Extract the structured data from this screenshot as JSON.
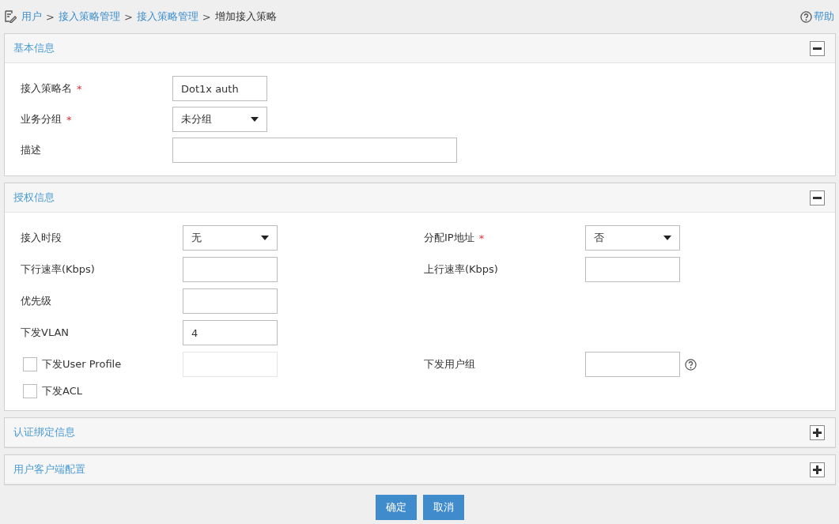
{
  "breadcrumb": [
    {
      "text": "用户",
      "link": true
    },
    {
      "text": "接入策略管理",
      "link": true
    },
    {
      "text": "接入策略管理",
      "link": true
    },
    {
      "text": "增加接入策略",
      "link": false
    }
  ],
  "breadcrumb_separator": ">",
  "help": "帮助",
  "sections": [
    {
      "title": "基本信息",
      "expanded": true,
      "kind": "single",
      "rows": [
        [
          {
            "kind": "text",
            "label": "接入策略名",
            "mark": "*",
            "value": "Dot1x auth"
          }
        ],
        [
          {
            "kind": "select",
            "label": "业务分组",
            "mark": "*",
            "value": "未分组"
          }
        ],
        [
          {
            "kind": "wide-text",
            "label": "描述"
          }
        ]
      ]
    },
    {
      "title": "授权信息",
      "expanded": true,
      "kind": "double",
      "rows": [
        [
          {
            "kind": "select",
            "label": "接入时段",
            "value": "无"
          },
          {
            "kind": "select",
            "label": "分配IP地址",
            "mark": "*",
            "value": "否"
          }
        ],
        [
          {
            "kind": "text",
            "label": "下行速率(Kbps)"
          },
          {
            "kind": "text",
            "label": "上行速率(Kbps)"
          }
        ],
        [
          {
            "kind": "text",
            "label": "优先级"
          }
        ],
        [
          {
            "kind": "text",
            "label": "下发VLAN",
            "value": "4"
          }
        ],
        [
          {
            "kind": "checkbox-input",
            "label": "下发User Profile",
            "checked": false,
            "disabled": true
          },
          {
            "kind": "text-help",
            "label": "下发用户组"
          }
        ],
        [
          {
            "kind": "checkbox",
            "label": "下发ACL",
            "checked": false
          }
        ]
      ]
    },
    {
      "title": "认证绑定信息",
      "expanded": false
    },
    {
      "title": "用户客户端配置",
      "expanded": false
    }
  ],
  "buttons": [
    "确定",
    "取消"
  ]
}
